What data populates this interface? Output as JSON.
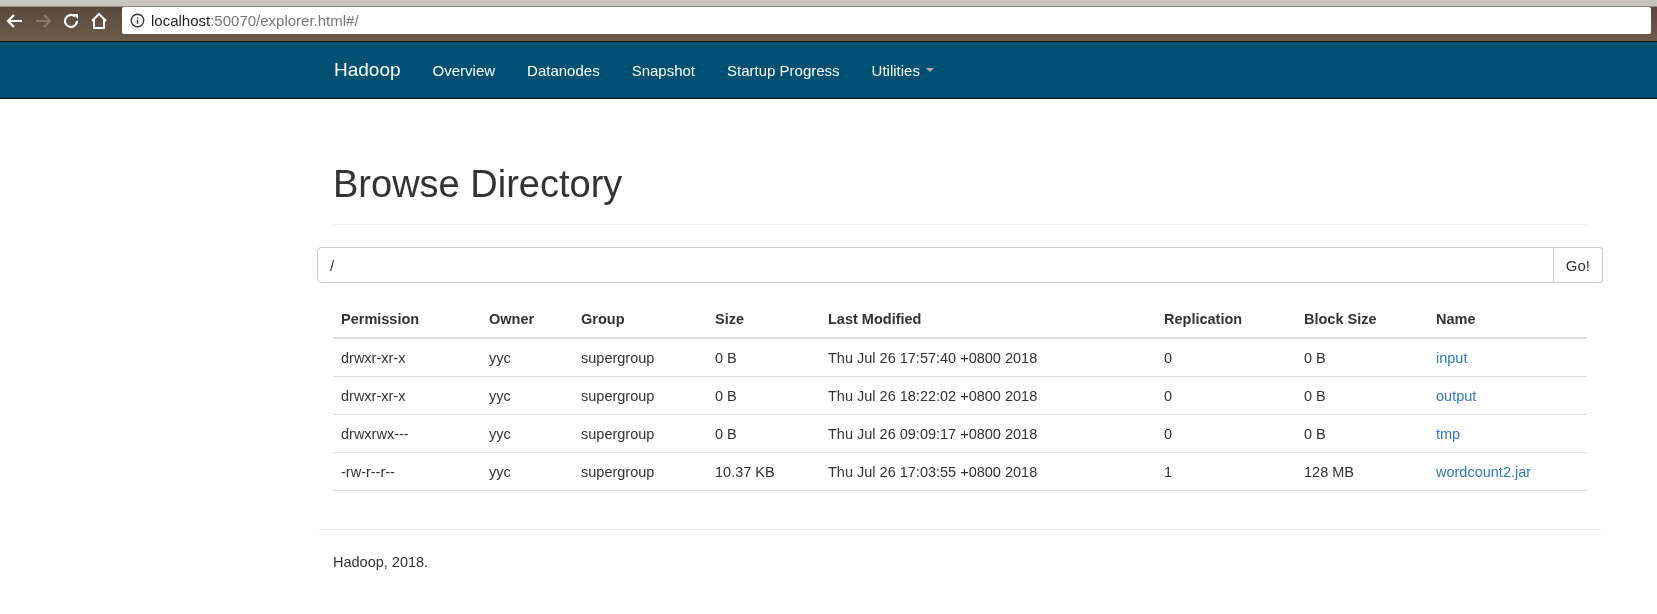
{
  "browser": {
    "address": {
      "host": "localhost",
      "path": ":50070/explorer.html#/"
    }
  },
  "navbar": {
    "brand": "Hadoop",
    "items": [
      {
        "label": "Overview",
        "kind": "link"
      },
      {
        "label": "Datanodes",
        "kind": "link"
      },
      {
        "label": "Snapshot",
        "kind": "link"
      },
      {
        "label": "Startup Progress",
        "kind": "link"
      },
      {
        "label": "Utilities",
        "kind": "dropdown"
      }
    ]
  },
  "page": {
    "title": "Browse Directory",
    "path_field": {
      "value": "/"
    },
    "go_button": "Go!"
  },
  "table": {
    "columns": [
      "Permission",
      "Owner",
      "Group",
      "Size",
      "Last Modified",
      "Replication",
      "Block Size",
      "Name"
    ],
    "rows": [
      [
        "drwxr-xr-x",
        "yyc",
        "supergroup",
        "0 B",
        "Thu Jul 26 17:57:40 +0800 2018",
        "0",
        "0 B",
        "input"
      ],
      [
        "drwxr-xr-x",
        "yyc",
        "supergroup",
        "0 B",
        "Thu Jul 26 18:22:02 +0800 2018",
        "0",
        "0 B",
        "output"
      ],
      [
        "drwxrwx---",
        "yyc",
        "supergroup",
        "0 B",
        "Thu Jul 26 09:09:17 +0800 2018",
        "0",
        "0 B",
        "tmp"
      ],
      [
        "-rw-r--r--",
        "yyc",
        "supergroup",
        "10.37 KB",
        "Thu Jul 26 17:03:55 +0800 2018",
        "1",
        "128 MB",
        "wordcount2.jar"
      ]
    ]
  },
  "footer": "Hadoop, 2018."
}
